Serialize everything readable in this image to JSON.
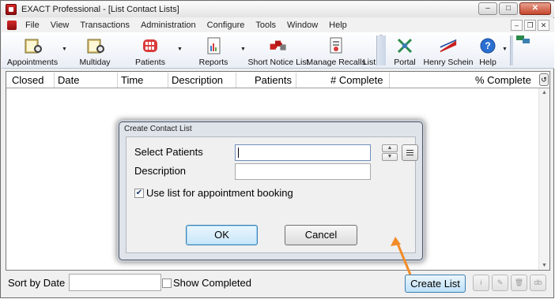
{
  "window": {
    "title": "EXACT Professional - [List Contact Lists]"
  },
  "menu": [
    "File",
    "View",
    "Transactions",
    "Administration",
    "Configure",
    "Tools",
    "Window",
    "Help"
  ],
  "toolbar": {
    "appointments": "Appointments",
    "multiday": "Multiday",
    "patients": "Patients",
    "reports": "Reports",
    "short_notice": "Short Notice List",
    "manage_recalls": "Manage Recalls",
    "list": "List",
    "portal": "Portal",
    "henry_schein": "Henry Schein",
    "help": "Help"
  },
  "list": {
    "columns": [
      "Closed",
      "Date",
      "Time",
      "Description",
      "Patients",
      "# Complete",
      "% Complete"
    ]
  },
  "dialog": {
    "title": "Create Contact List",
    "select_patients_label": "Select Patients",
    "description_label": "Description",
    "use_list_label": "Use list for appointment booking",
    "use_list_checked": true,
    "ok": "OK",
    "cancel": "Cancel"
  },
  "bottom": {
    "sort_label": "Sort by Date",
    "show_completed": "Show Completed",
    "create_list": "Create List"
  },
  "colors": {
    "annotation_arrow": "#f28c28",
    "brand_red": "#c9201f",
    "default_button": "#3c7fb1"
  }
}
